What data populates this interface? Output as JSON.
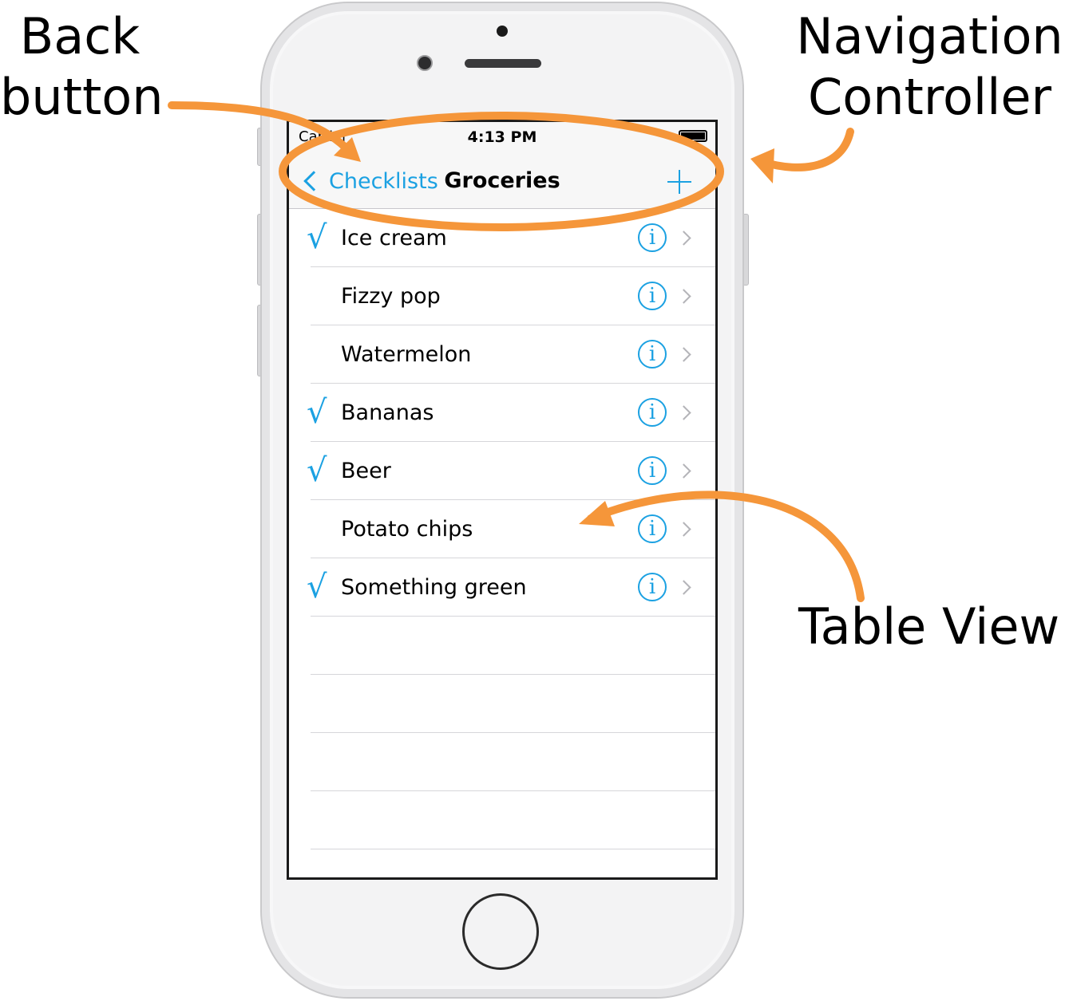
{
  "annotations": {
    "back_button": [
      "Back",
      "button"
    ],
    "navigation_controller": [
      "Navigation",
      "Controller"
    ],
    "table_view": "Table View"
  },
  "status_bar": {
    "carrier": "Carrier",
    "time": "4:13 PM"
  },
  "nav_bar": {
    "back_label": "Checklists",
    "title": "Groceries",
    "add_icon": "plus-icon"
  },
  "items": [
    {
      "label": "Ice cream",
      "checked": true
    },
    {
      "label": "Fizzy pop",
      "checked": false
    },
    {
      "label": "Watermelon",
      "checked": false
    },
    {
      "label": "Bananas",
      "checked": true
    },
    {
      "label": "Beer",
      "checked": true
    },
    {
      "label": "Potato chips",
      "checked": false
    },
    {
      "label": "Something green",
      "checked": true
    }
  ],
  "icons": {
    "check": "√",
    "info": "i"
  },
  "colors": {
    "accent": "#1ba1e2",
    "annotation": "#f5963a"
  }
}
